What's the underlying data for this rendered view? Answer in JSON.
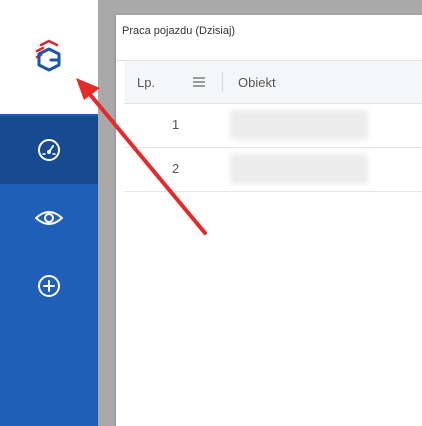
{
  "sidebar": {
    "logo_icon": "brand-logo-icon",
    "items": [
      {
        "icon": "dashboard-gauge-icon",
        "active": true
      },
      {
        "icon": "eye-icon",
        "active": false
      },
      {
        "icon": "plus-circle-icon",
        "active": false
      }
    ]
  },
  "panel": {
    "title": "Praca pojazdu (Dzisiaj)"
  },
  "table": {
    "columns": [
      "Lp.",
      "Obiekt"
    ],
    "menu_icon": "hamburger-menu-icon",
    "rows": [
      {
        "lp": "1"
      },
      {
        "lp": "2"
      }
    ]
  },
  "annotation": {
    "arrow_color": "#e62a2a"
  },
  "colors": {
    "sidebar": "#1f5fb8",
    "sidebar_active": "#184a92",
    "logo_red": "#d9283a",
    "logo_blue": "#1d56a8"
  }
}
